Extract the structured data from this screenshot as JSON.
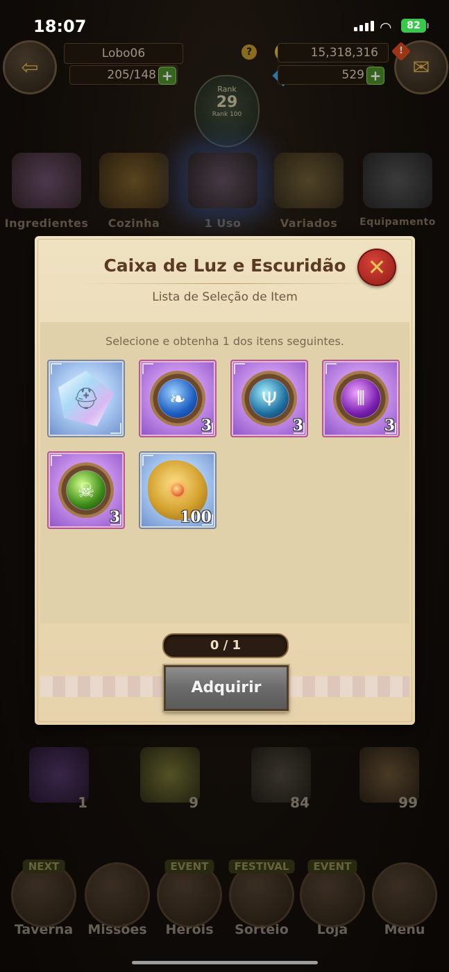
{
  "status_bar": {
    "time": "18:07",
    "battery": "82"
  },
  "hud": {
    "username": "Lobo06",
    "stamina": "205/148",
    "rank_title": "Rank",
    "rank_value": "29",
    "rank_sub": "Rank 100",
    "gold": "15,318,316",
    "gems": "529"
  },
  "categories": [
    {
      "label": "Ingredientes",
      "icon": "ingredients-icon"
    },
    {
      "label": "Cozinha",
      "icon": "food-icon"
    },
    {
      "label": "1 Uso",
      "icon": "chest-icon"
    },
    {
      "label": "Variados",
      "icon": "misc-icon"
    },
    {
      "label": "Equipamento",
      "icon": "armor-icon"
    }
  ],
  "shelf_counts": [
    "1",
    "9",
    "84",
    "99"
  ],
  "bottom_nav": [
    {
      "label": "Taverna",
      "tag": "NEXT"
    },
    {
      "label": "Missões",
      "tag": ""
    },
    {
      "label": "Heróis",
      "tag": "EVENT"
    },
    {
      "label": "Sorteio",
      "tag": "FESTIVAL"
    },
    {
      "label": "Loja",
      "tag": "EVENT"
    },
    {
      "label": "Menu",
      "tag": ""
    }
  ],
  "modal": {
    "title": "Caixa de Luz e Escuridão",
    "subtitle": "Lista de Seleção de Item",
    "hint": "Selecione e obtenha 1 dos itens seguintes.",
    "items": [
      {
        "icon": "crystal-helmet-icon",
        "rarity": "blue",
        "qty": ""
      },
      {
        "icon": "blue-feather-rune-icon",
        "rarity": "purple",
        "qty": "3"
      },
      {
        "icon": "teal-antler-rune-icon",
        "rarity": "purple",
        "qty": "3"
      },
      {
        "icon": "violet-claw-rune-icon",
        "rarity": "purple",
        "qty": "3"
      },
      {
        "icon": "green-dragon-rune-icon",
        "rarity": "purple",
        "qty": "3"
      },
      {
        "icon": "gold-seal-icon",
        "rarity": "blue",
        "qty": "100"
      }
    ],
    "counter": "0 / 1",
    "acquire_label": "Adquirir"
  }
}
